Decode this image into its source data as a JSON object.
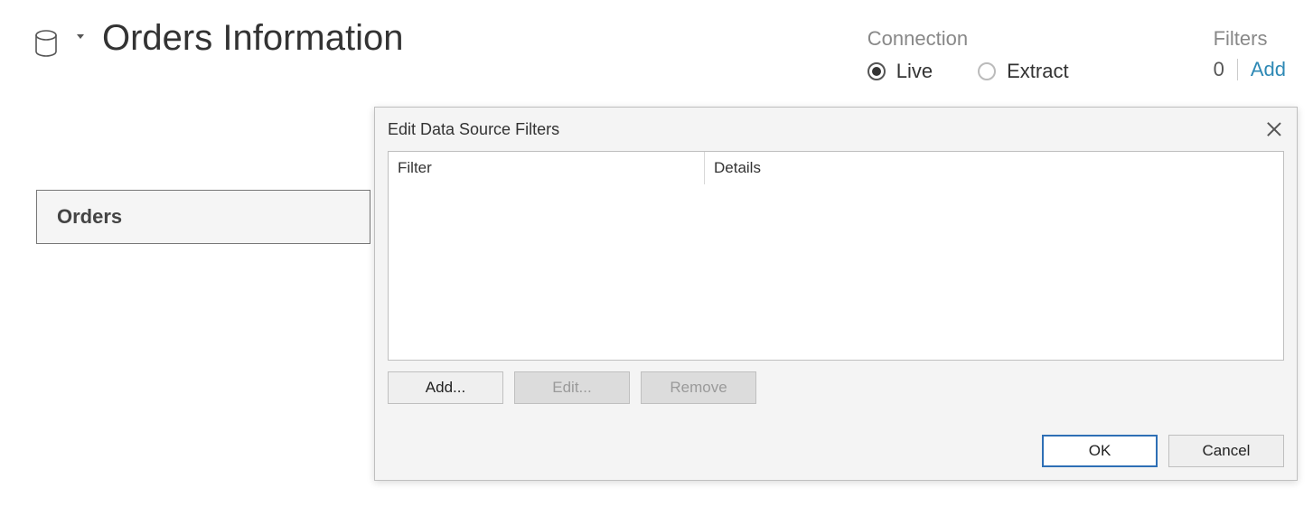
{
  "header": {
    "title": "Orders Information"
  },
  "connection": {
    "label": "Connection",
    "options": {
      "live": "Live",
      "extract": "Extract"
    },
    "selected": "live"
  },
  "filters": {
    "label": "Filters",
    "count": "0",
    "add": "Add"
  },
  "canvas": {
    "table": "Orders"
  },
  "dialog": {
    "title": "Edit Data Source Filters",
    "columns": {
      "filter": "Filter",
      "details": "Details"
    },
    "buttons": {
      "add": "Add...",
      "edit": "Edit...",
      "remove": "Remove",
      "ok": "OK",
      "cancel": "Cancel"
    }
  }
}
